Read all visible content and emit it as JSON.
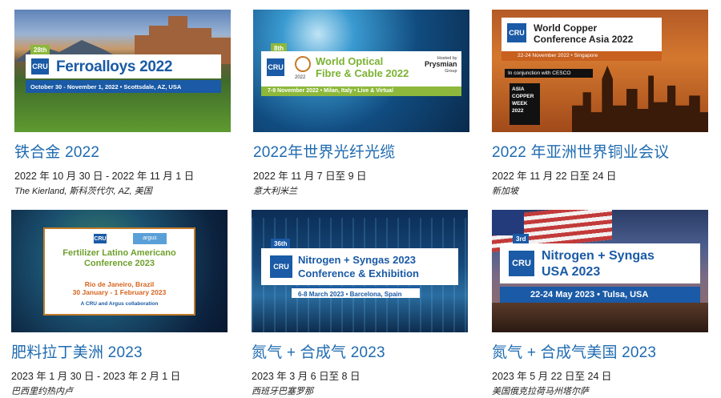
{
  "events": [
    {
      "title": "铁合金 2022",
      "date": "2022 年 10 月 30 日 - 2022 年 11 月 1 日",
      "venue": "The Kierland, 斯科茨代尔, AZ, 美国",
      "banner": {
        "edition": "28th",
        "logo": "CRU",
        "name": "Ferroalloys 2022",
        "strip": "October 30 - November 1, 2022 • Scottsdale, AZ, USA"
      }
    },
    {
      "title": "2022年世界光纤光缆",
      "date": "2022 年 11 月 7 日至 9 日",
      "venue": "意大利米兰",
      "banner": {
        "edition": "8th",
        "logo": "CRU",
        "name_line1": "World Optical",
        "name_line2": "Fibre & Cable 2022",
        "globe_year": "2022",
        "host_label": "Hosted by",
        "host_name": "Prysmian",
        "host_sub": "Group",
        "strip": "7-9 November 2022 • Milan, Italy • Live & Virtual"
      }
    },
    {
      "title": "2022 年亚洲世界铜业会议",
      "date": "2022 年 11 月 22 日至 24 日",
      "venue": "新加坡",
      "banner": {
        "logo": "CRU",
        "name_line1": "World Copper",
        "name_line2": "Conference Asia 2022",
        "strip": "22-24 November 2022 • Singapore",
        "cesco": "In conjunction with CESCO",
        "week_line1": "ASIA",
        "week_line2": "COPPER",
        "week_line3": "WEEK",
        "week_line4": "2022"
      }
    },
    {
      "title": "肥料拉丁美洲 2023",
      "date": "2023 年 1 月 30 日 - 2023 年 2 月 1 日",
      "venue": "巴西里约热内卢",
      "banner": {
        "logo": "CRU",
        "partner": "argus",
        "name_line1": "Fertilizer Latino Americano",
        "name_line2": "Conference 2023",
        "place": "Rio de Janeiro, Brazil",
        "dates": "30 January - 1 February 2023",
        "collab": "A CRU and Argus collaboration"
      }
    },
    {
      "title": "氮气 + 合成气 2023",
      "date": "2023 年 3 月 6 日至 8 日",
      "venue": "西班牙巴塞罗那",
      "banner": {
        "edition": "36th",
        "logo": "CRU",
        "name_line1": "Nitrogen + Syngas 2023",
        "name_line2": "Conference & Exhibition",
        "strip": "6-8 March 2023 • Barcelona, Spain"
      }
    },
    {
      "title": "氮气 + 合成气美国 2023",
      "date": "2023 年 5 月 22 日至 24 日",
      "venue": "美国俄克拉荷马州塔尔萨",
      "banner": {
        "edition": "3rd",
        "logo": "CRU",
        "name_line1": "Nitrogen + Syngas",
        "name_line2": "USA 2023",
        "strip": "22-24 May 2023 • Tulsa, USA"
      }
    }
  ]
}
